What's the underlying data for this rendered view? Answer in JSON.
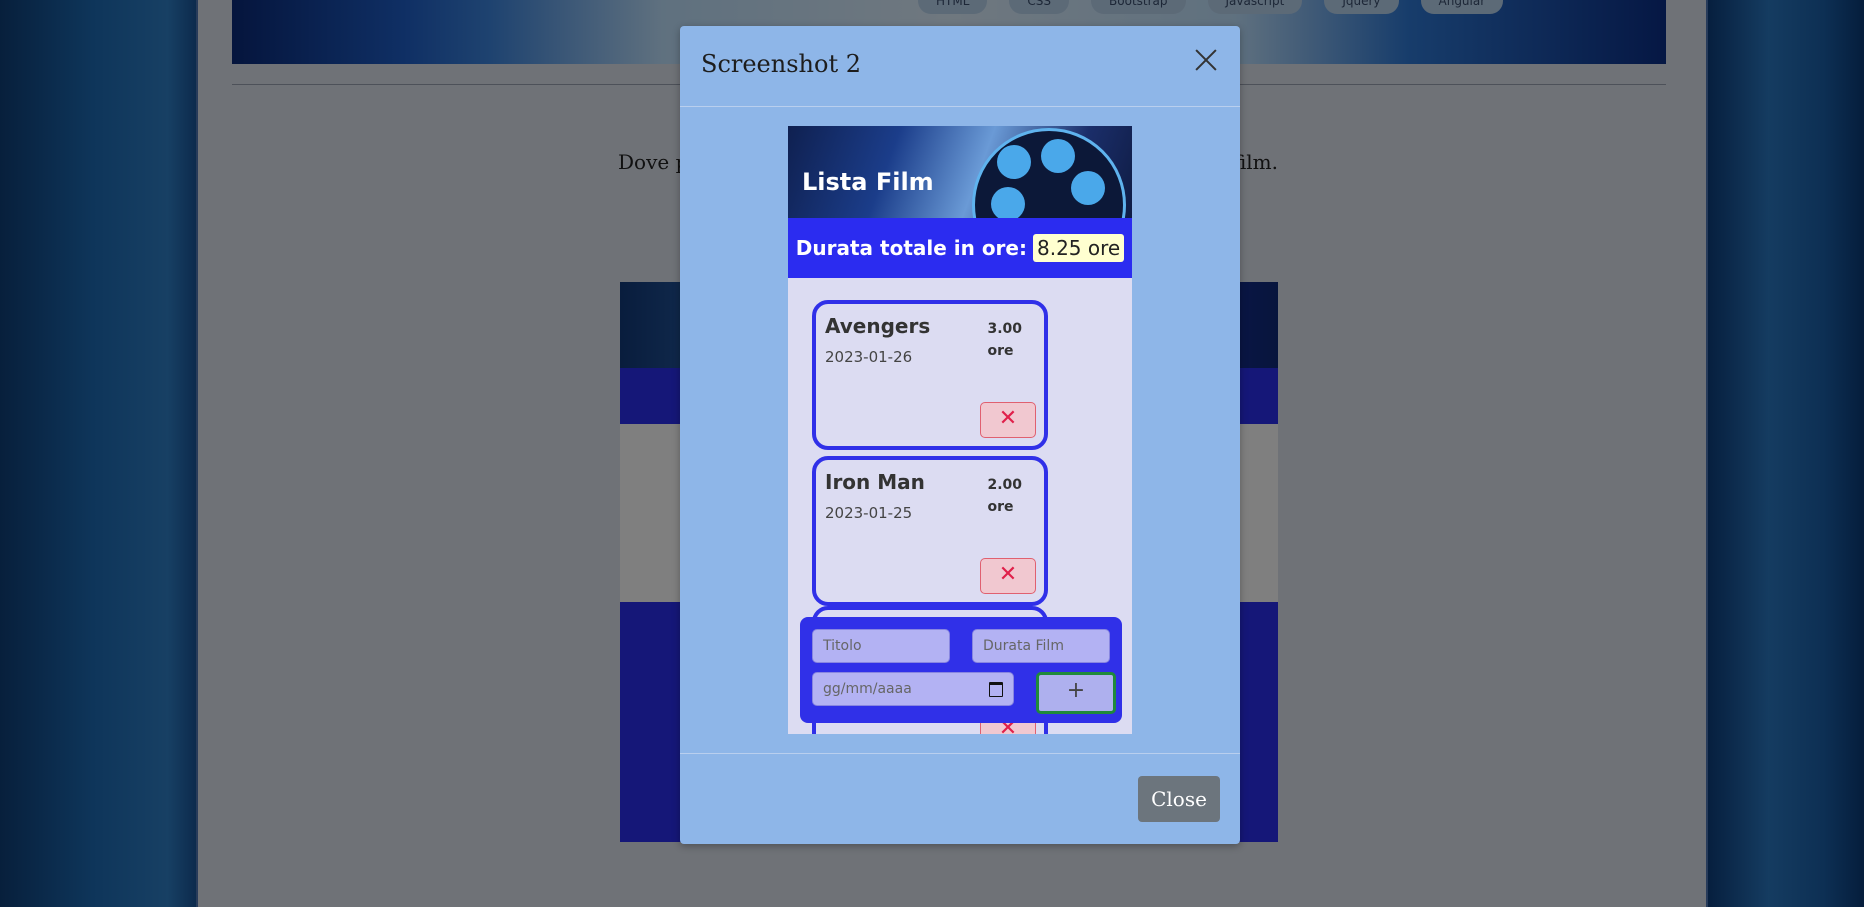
{
  "background_page": {
    "nav_pills": [
      "HTML",
      "CSS",
      "Bootstrap",
      "Javascript",
      "Jquery",
      "Angular"
    ],
    "intro_text_start": "Dove p",
    "intro_text_end": "film."
  },
  "modal": {
    "title": "Screenshot 2",
    "close_button": "Close"
  },
  "app": {
    "title": "Lista Film",
    "total_label": "Durata totale in ore:",
    "total_value": "8.25 ore",
    "films": [
      {
        "title": "Avengers",
        "date": "2023-01-26",
        "hours": "3.00",
        "unit": "ore",
        "delete_label": "✕"
      },
      {
        "title": "Iron Man",
        "date": "2023-01-25",
        "hours": "2.00",
        "unit": "ore",
        "delete_label": "✕"
      }
    ],
    "form": {
      "title_placeholder": "Titolo",
      "duration_placeholder": "Durata Film",
      "date_placeholder": "gg/mm/aaaa",
      "add_label": "+"
    }
  },
  "colors": {
    "accent_blue": "#2b2cf0",
    "modal_bg": "#8eb6e8",
    "close_button_bg": "#6c757d"
  }
}
